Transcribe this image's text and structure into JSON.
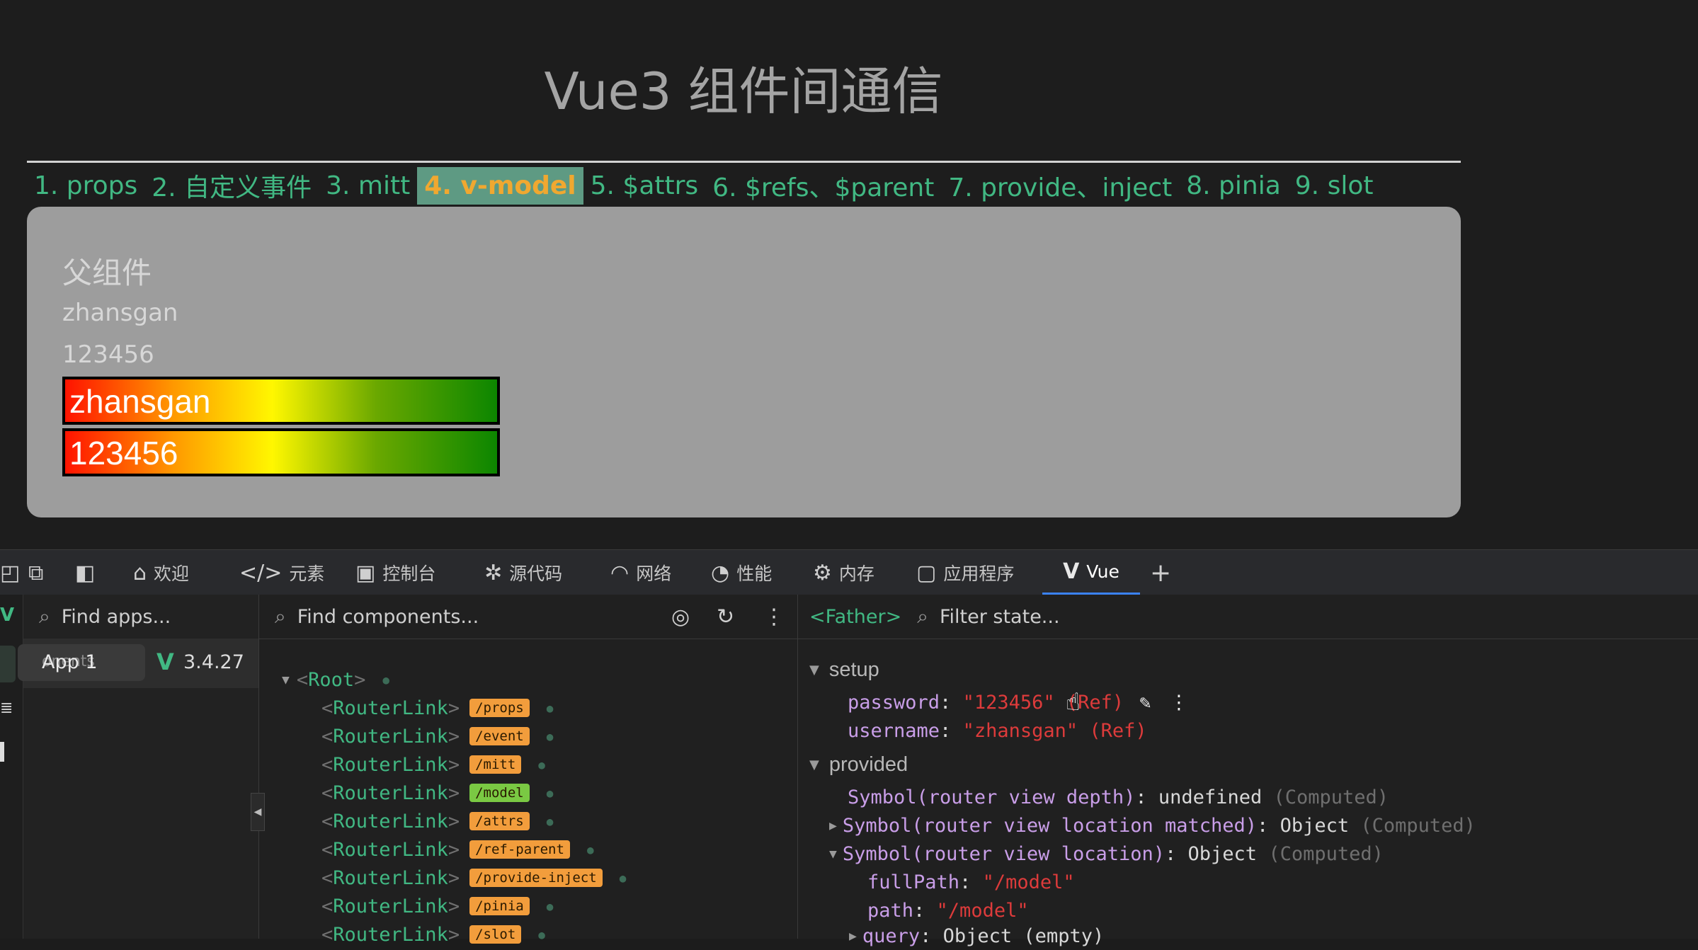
{
  "page": {
    "title": "Vue3 组件间通信",
    "nav": [
      {
        "label": "1. props"
      },
      {
        "label": "2. 自定义事件"
      },
      {
        "label": "3. mitt"
      },
      {
        "label": "4. v-model",
        "active": true
      },
      {
        "label": "5. $attrs"
      },
      {
        "label": "6. $refs、$parent"
      },
      {
        "label": "7. provide、inject"
      },
      {
        "label": "8. pinia"
      },
      {
        "label": "9. slot"
      }
    ],
    "panel": {
      "title": "父组件",
      "username_text": "zhansgan",
      "password_text": "123456",
      "input_username": "zhansgan",
      "input_password": "123456"
    }
  },
  "devtools": {
    "tabs": [
      {
        "label": "欢迎",
        "icon": "home-icon"
      },
      {
        "label": "元素",
        "icon": "code-icon"
      },
      {
        "label": "控制台",
        "icon": "console-icon"
      },
      {
        "label": "源代码",
        "icon": "bug-icon"
      },
      {
        "label": "网络",
        "icon": "wifi-icon"
      },
      {
        "label": "性能",
        "icon": "gauge-icon"
      },
      {
        "label": "内存",
        "icon": "chip-icon"
      },
      {
        "label": "应用程序",
        "icon": "window-icon"
      },
      {
        "label": "Vue",
        "icon": "vue-icon",
        "selected": true
      }
    ],
    "apps": {
      "placeholder": "Find apps...",
      "app_name": "App 1",
      "app_name_overlay": "onents",
      "version": "3.4.27"
    },
    "components": {
      "placeholder": "Find components...",
      "root": "Root",
      "router_links": [
        {
          "name": "RouterLink",
          "path": "/props"
        },
        {
          "name": "RouterLink",
          "path": "/event"
        },
        {
          "name": "RouterLink",
          "path": "/mitt"
        },
        {
          "name": "RouterLink",
          "path": "/model",
          "active": true
        },
        {
          "name": "RouterLink",
          "path": "/attrs"
        },
        {
          "name": "RouterLink",
          "path": "/ref-parent"
        },
        {
          "name": "RouterLink",
          "path": "/provide-inject"
        },
        {
          "name": "RouterLink",
          "path": "/pinia"
        },
        {
          "name": "RouterLink",
          "path": "/slot"
        }
      ]
    },
    "state": {
      "component": "<Father>",
      "placeholder": "Filter state...",
      "setup_label": "setup",
      "setup": [
        {
          "key": "password",
          "value": "\"123456\"",
          "tag": "(Ref)"
        },
        {
          "key": "username",
          "value": "\"zhansgan\"",
          "tag": "(Ref)"
        }
      ],
      "provided_label": "provided",
      "provided": [
        {
          "key": "Symbol(router view depth)",
          "value": "undefined",
          "tag": "(Computed)"
        },
        {
          "key": "Symbol(router view location matched)",
          "value": "Object",
          "tag": "(Computed)"
        },
        {
          "key": "Symbol(router view location)",
          "value": "Object",
          "tag": "(Computed)"
        }
      ],
      "location_children": [
        {
          "key": "fullPath",
          "value": "\"/model\""
        },
        {
          "key": "path",
          "value": "\"/model\""
        },
        {
          "key": "query",
          "value": "Object (empty)"
        }
      ]
    },
    "colors": {
      "vue_green": "#41b883",
      "accent": "#3b82f6"
    }
  }
}
